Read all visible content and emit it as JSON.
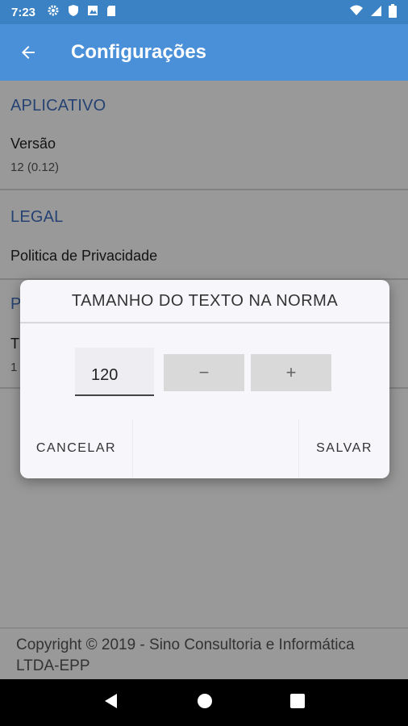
{
  "status_bar": {
    "time": "7:23",
    "left_icons": [
      "gear-icon",
      "shield-icon",
      "image-icon",
      "sd-card-icon"
    ],
    "right_icons": [
      "wifi-icon",
      "signal-icon",
      "battery-icon"
    ]
  },
  "app_bar": {
    "title": "Configurações",
    "background": "#4a90d8"
  },
  "sections": [
    {
      "header": "APLICATIVO",
      "item_title": "Versão",
      "item_sub": "12 (0.12)"
    },
    {
      "header": "LEGAL",
      "item_title": "Politica de Privacidade"
    },
    {
      "header": "P",
      "item_title": "T",
      "item_sub": "1"
    }
  ],
  "footer": {
    "text": "Copyright © 2019 - Sino Consultoria e Informática LTDA-EPP"
  },
  "dialog": {
    "title": "TAMANHO DO TEXTO NA NORMA",
    "value": "120",
    "minus_label": "−",
    "plus_label": "+",
    "cancel_label": "CANCELAR",
    "save_label": "SALVAR"
  },
  "colors": {
    "accent": "#4a90d8",
    "section_header": "#3f6fbf"
  }
}
